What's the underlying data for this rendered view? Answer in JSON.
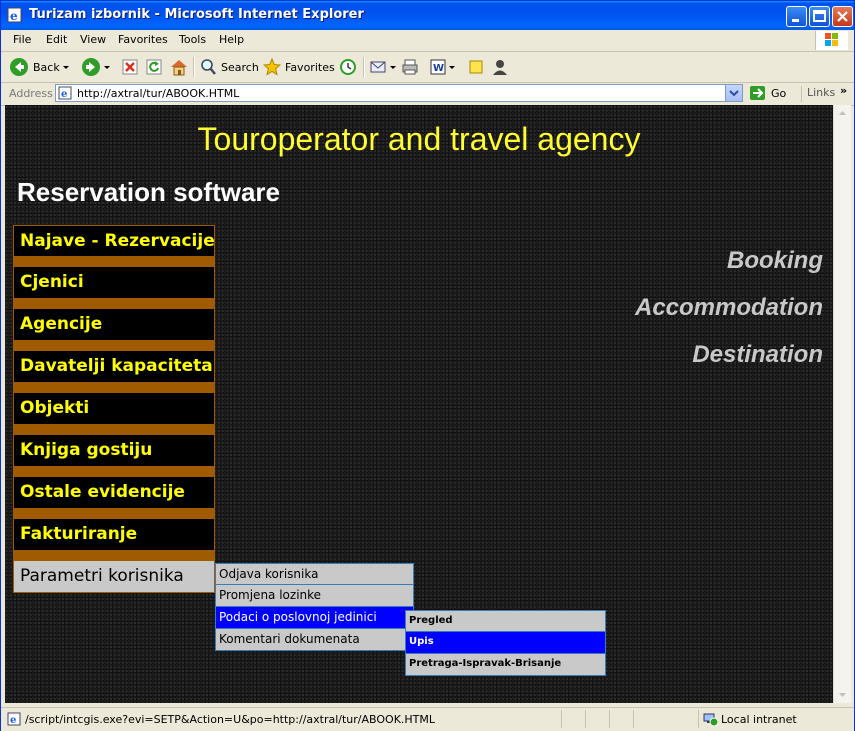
{
  "window": {
    "title": "Turizam izbornik - Microsoft Internet Explorer"
  },
  "menubar": {
    "items": [
      "File",
      "Edit",
      "View",
      "Favorites",
      "Tools",
      "Help"
    ]
  },
  "toolbar": {
    "back_label": "Back",
    "search_label": "Search",
    "favorites_label": "Favorites"
  },
  "addressbar": {
    "label": "Address",
    "url": "http://axtral/tur/ABOOK.HTML",
    "go_label": "Go",
    "links_label": "Links"
  },
  "page": {
    "heading": "Touroperator and travel agency",
    "subheading": "Reservation software",
    "right_labels": [
      "Booking",
      "Accommodation",
      "Destination"
    ],
    "nav": [
      "Najave - Rezervacije",
      "Cjenici",
      "Agencije",
      "Davatelji kapaciteta",
      "Objekti",
      "Knjiga gostiju",
      "Ostale evidencije",
      "Fakturiranje",
      "Parametri korisnika"
    ],
    "submenu": [
      "Odjava korisnika",
      "Promjena lozinke",
      "Podaci o poslovnoj jedinici",
      "Komentari dokumenata"
    ],
    "submenu2": [
      "Pregled",
      "Upis",
      "Pretraga-Ispravak-Brisanje"
    ]
  },
  "status": {
    "text": "/script/intcgis.exe?evi=SETP&Action=U&po=http://axtral/tur/ABOOK.HTML",
    "zone": "Local intranet"
  },
  "colors": {
    "heading": "#ffff33",
    "nav_text": "#ffff00",
    "nav_border": "#a05b00",
    "highlight": "#0000ff"
  }
}
